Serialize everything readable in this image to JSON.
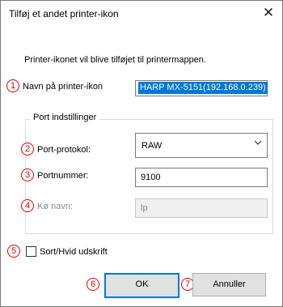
{
  "window": {
    "title": "Tilføj et andet printer-ikon",
    "close_glyph": "✕"
  },
  "description": "Printer-ikonet vil blive tilføjet til printermappen.",
  "markers": [
    "1",
    "2",
    "3",
    "4",
    "5",
    "6",
    "7"
  ],
  "fields": {
    "name_label": "Navn på printer-ikon",
    "name_value": "HARP MX-5151(192.168.0.239)",
    "group_title": "Port indstillinger",
    "protocol_label": "Port-protokol:",
    "protocol_value": "RAW",
    "port_label": "Portnummer:",
    "port_value": "9100",
    "queue_label": "Kø navn:",
    "queue_value": "lp",
    "bw_label": "Sort/Hvid udskrift"
  },
  "buttons": {
    "ok": "OK",
    "cancel": "Annuller"
  },
  "colors": {
    "marker": "#e00000",
    "selection": "#0078d7"
  }
}
